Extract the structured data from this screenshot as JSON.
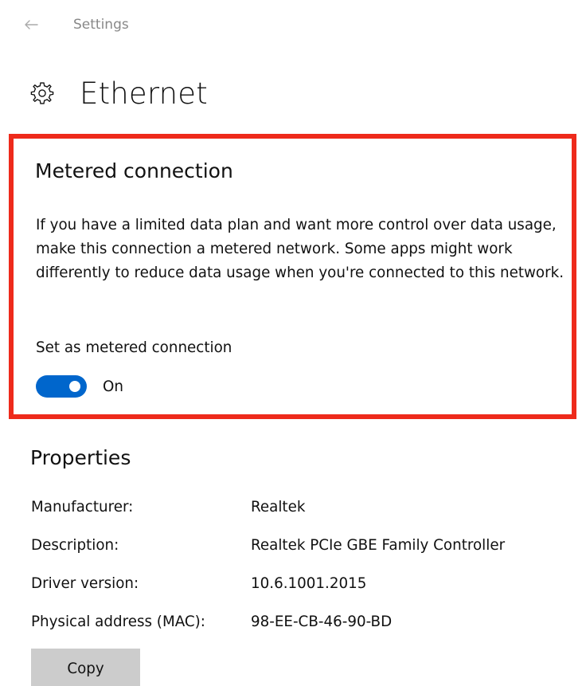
{
  "header": {
    "back_icon": "back-arrow-icon",
    "app_title": "Settings"
  },
  "page": {
    "icon": "gear-icon",
    "title": "Ethernet"
  },
  "metered": {
    "heading": "Metered connection",
    "description": "If you have a limited data plan and want more control over data usage, make this connection a metered network. Some apps might work differently to reduce data usage when you're connected to this network.",
    "toggle_label": "Set as metered connection",
    "toggle_state": "On",
    "toggle_on": true,
    "highlight_color": "#ee2a1b",
    "accent_color": "#0066cc"
  },
  "properties": {
    "heading": "Properties",
    "rows": [
      {
        "label": "Manufacturer:",
        "value": "Realtek"
      },
      {
        "label": "Description:",
        "value": "Realtek PCIe GBE Family Controller"
      },
      {
        "label": "Driver version:",
        "value": "10.6.1001.2015"
      },
      {
        "label": "Physical address (MAC):",
        "value": "98-EE-CB-46-90-BD"
      }
    ],
    "copy_label": "Copy"
  }
}
